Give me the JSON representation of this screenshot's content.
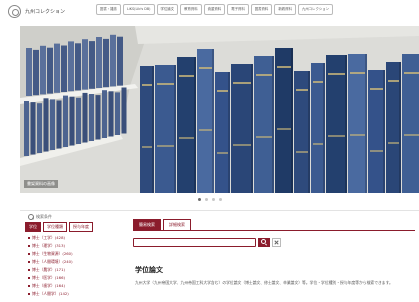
{
  "header": {
    "logo_text": "九州コレクション",
    "nav": [
      "図書・雑誌",
      "LiKS(Lib's DB)",
      "学位論文",
      "教育資料",
      "貴重資料",
      "電子資料",
      "図書資料",
      "新着資料",
      "九州コレクション"
    ]
  },
  "hero": {
    "caption": "書架資料の画像"
  },
  "carousel": {
    "count": 4,
    "active": 0
  },
  "sidebar": {
    "search_label": "検索条件",
    "tabs": [
      {
        "label": "学位",
        "active": true
      },
      {
        "label": "学位種類",
        "active": false
      },
      {
        "label": "授与年度",
        "active": false
      }
    ],
    "items": [
      "博士（工学）(428)",
      "博士（理学）(313)",
      "博士（生物資源）(260)",
      "博士（人間環境）(240)",
      "博士（農学）(171)",
      "博士（医学）(166)",
      "博士（歯学）(164)",
      "博士（人間学）(142)"
    ]
  },
  "main": {
    "tabs": [
      {
        "label": "簡易検索",
        "active": true
      },
      {
        "label": "詳細検索",
        "active": false
      }
    ],
    "search": {
      "value": "",
      "placeholder": ""
    },
    "section_title": "学位論文",
    "section_body": "九州大学（九州帝国大学、九州帝国工科大学含む）の学位論文（博士論文、修士論文、卒業論文）等。学位・学位種別・授与年度等から検索できます。"
  },
  "colors": {
    "accent": "#8b1c2c"
  }
}
